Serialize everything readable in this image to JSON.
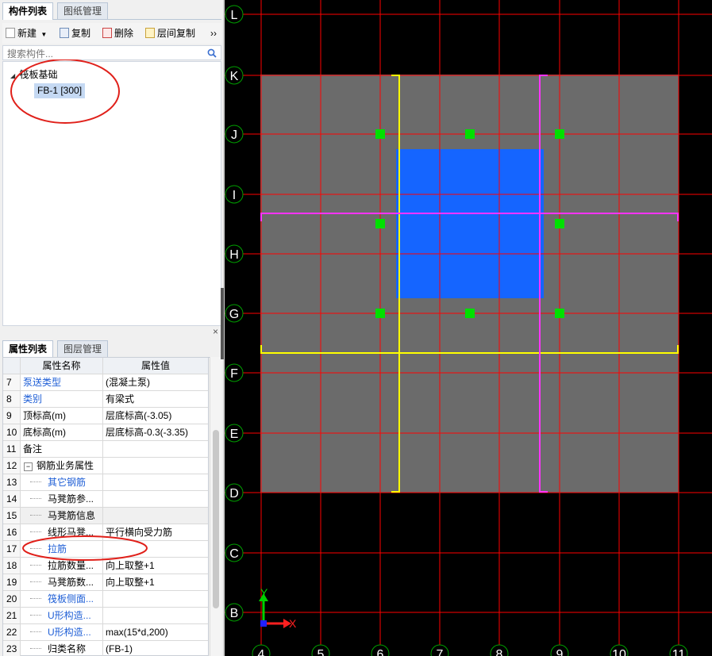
{
  "component_panel": {
    "tabs": [
      "构件列表",
      "图纸管理"
    ],
    "toolbar": {
      "new": "新建",
      "copy": "复制",
      "delete": "删除",
      "floor_copy": "层间复制",
      "more": "››"
    },
    "search_placeholder": "搜索构件...",
    "tree": {
      "category": "筏板基础",
      "item": "FB-1 [300]"
    }
  },
  "property_panel": {
    "tabs": [
      "属性列表",
      "图层管理"
    ],
    "close": "×",
    "headers": {
      "name": "属性名称",
      "value": "属性值"
    },
    "rows": [
      {
        "num": "7",
        "name": "泵送类型",
        "value": "(混凝土泵)",
        "link": true
      },
      {
        "num": "8",
        "name": "类别",
        "value": "有梁式",
        "link": true
      },
      {
        "num": "9",
        "name": "顶标高(m)",
        "value": "层底标高(-3.05)"
      },
      {
        "num": "10",
        "name": "底标高(m)",
        "value": "层底标高-0.3(-3.35)"
      },
      {
        "num": "11",
        "name": "备注",
        "value": ""
      },
      {
        "num": "12",
        "name": "钢筋业务属性",
        "value": "",
        "group": true,
        "toggle": "−"
      },
      {
        "num": "13",
        "name": "其它钢筋",
        "value": "",
        "link": true,
        "sub": true
      },
      {
        "num": "14",
        "name": "马凳筋参...",
        "value": "",
        "sub": true
      },
      {
        "num": "15",
        "name": "马凳筋信息",
        "value": "",
        "sub": true,
        "gray": true
      },
      {
        "num": "16",
        "name": "线形马凳...",
        "value": "平行横向受力筋",
        "sub": true
      },
      {
        "num": "17",
        "name": "拉筋",
        "value": "",
        "link": true,
        "sub": true
      },
      {
        "num": "18",
        "name": "拉筋数量...",
        "value": "向上取整+1",
        "sub": true
      },
      {
        "num": "19",
        "name": "马凳筋数...",
        "value": "向上取整+1",
        "sub": true
      },
      {
        "num": "20",
        "name": "筏板侧面...",
        "value": "",
        "link": true,
        "sub": true
      },
      {
        "num": "21",
        "name": "U形构造...",
        "value": "",
        "link": true,
        "sub": true
      },
      {
        "num": "22",
        "name": "U形构造...",
        "value": "max(15*d,200)",
        "link": true,
        "sub": true
      },
      {
        "num": "23",
        "name": "归类名称",
        "value": "(FB-1)",
        "sub": true
      }
    ]
  },
  "canvas": {
    "row_axes": [
      "L",
      "K",
      "J",
      "I",
      "H",
      "G",
      "F",
      "E",
      "D",
      "C",
      "B"
    ],
    "col_axes": [
      "4",
      "5",
      "6",
      "7",
      "8",
      "9",
      "10",
      "11"
    ],
    "ucs": {
      "x": "X",
      "y": "Y"
    },
    "colors": {
      "background": "#000000",
      "grid": "#ff0000",
      "slab": "#6b6b6b",
      "opening": "#1565ff",
      "yellow_beam": "#ffff00",
      "magenta_beam": "#ff33ff",
      "point": "#00e000",
      "axis_bubble": "#00a000"
    }
  }
}
